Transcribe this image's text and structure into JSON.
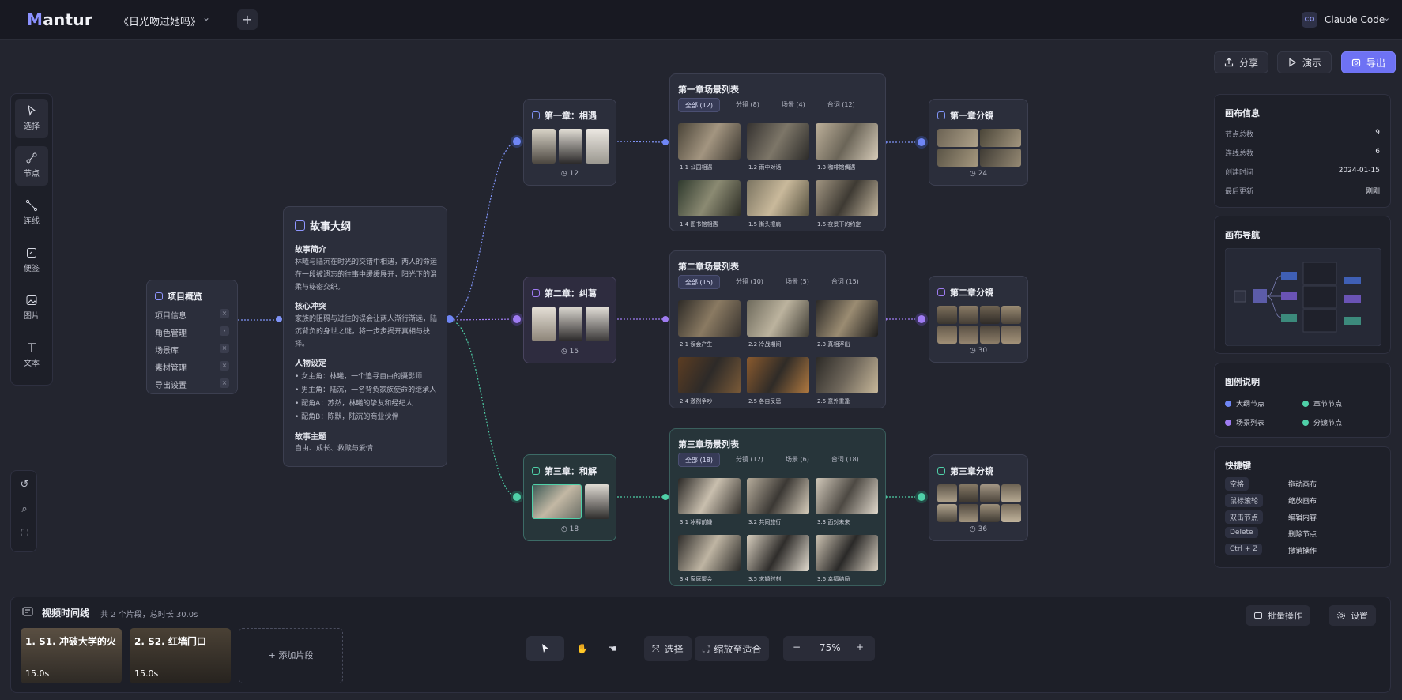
{
  "app": {
    "logo": "antur",
    "logo_initial": "M",
    "project_title": "《日光吻过她吗》",
    "agent_label": "Claude Code",
    "agent_icon_text": "CO"
  },
  "actions": {
    "share": "分享",
    "present": "演示",
    "export": "导出"
  },
  "tools": [
    {
      "label": "选择",
      "icon": "cursor-icon"
    },
    {
      "label": "节点",
      "icon": "node-icon"
    },
    {
      "label": "连线",
      "icon": "connector-icon"
    },
    {
      "label": "便签",
      "icon": "note-icon"
    },
    {
      "label": "图片",
      "icon": "image-icon"
    },
    {
      "label": "文本",
      "icon": "text-icon"
    }
  ],
  "overview": {
    "title": "项目概览",
    "items": [
      "项目信息",
      "角色管理",
      "场景库",
      "素材管理",
      "导出设置"
    ]
  },
  "outline": {
    "title": "故事大纲",
    "synopsis_h": "故事简介",
    "synopsis": "林曦与陆沉在时光的交错中相遇，两人的命运在一段被遗忘的往事中缓缓展开，阳光下的温柔与秘密交织。",
    "conflict_h": "核心冲突",
    "conflict": "家族的阻碍与过往的误会让两人渐行渐远，陆沉背负的身世之谜，将一步步揭开真相与抉择。",
    "characters_h": "人物设定",
    "characters": [
      "女主角：林曦，一个追寻自由的摄影师",
      "男主角：陆沉，一名背负家族使命的继承人",
      "配角A：苏然，林曦的挚友和经纪人",
      "配角B：陈默，陆沉的商业伙伴"
    ],
    "theme_h": "故事主题",
    "theme": "自由、成长、救赎与爱情"
  },
  "chapters": [
    {
      "title": "第一章：相遇",
      "count": "12"
    },
    {
      "title": "第二章：纠葛",
      "count": "15"
    },
    {
      "title": "第三章：和解",
      "count": "18"
    }
  ],
  "scenes": [
    {
      "title": "第一章场景列表",
      "tabs": [
        "全部 (12)",
        "分镜 (8)",
        "场景 (4)",
        "台词 (12)"
      ],
      "shots": [
        "1.1 公园相遇",
        "1.2 雨中对话",
        "1.3 咖啡馆偶遇",
        "1.4 图书馆相遇",
        "1.5 街头擦肩",
        "1.6 夜景下的约定"
      ]
    },
    {
      "title": "第二章场景列表",
      "tabs": [
        "全部 (15)",
        "分镜 (10)",
        "场景 (5)",
        "台词 (15)"
      ],
      "shots": [
        "2.1 误会产生",
        "2.2 冷战期间",
        "2.3 真相浮出",
        "2.4 激烈争吵",
        "2.5 各自反思",
        "2.6 意外重逢"
      ]
    },
    {
      "title": "第三章场景列表",
      "tabs": [
        "全部 (18)",
        "分镜 (12)",
        "场景 (6)",
        "台词 (18)"
      ],
      "shots": [
        "3.1 冰释前嫌",
        "3.2 共同旅行",
        "3.3 面对未来",
        "3.4 家庭聚会",
        "3.5 求婚时刻",
        "3.6 幸福结局"
      ]
    }
  ],
  "storyboards": [
    {
      "title": "第一章分镜",
      "count": "24"
    },
    {
      "title": "第二章分镜",
      "count": "30"
    },
    {
      "title": "第三章分镜",
      "count": "36"
    }
  ],
  "canvas_info": {
    "title": "画布信息",
    "rows": [
      {
        "k": "节点总数",
        "v": "9"
      },
      {
        "k": "连线总数",
        "v": "6"
      },
      {
        "k": "创建时间",
        "v": "2024-01-15"
      },
      {
        "k": "最后更新",
        "v": "刚刚"
      }
    ]
  },
  "canvas_nav": {
    "title": "画布导航"
  },
  "legend": {
    "title": "图例说明",
    "items": [
      "大纲节点",
      "章节节点",
      "场景列表",
      "分镜节点"
    ],
    "colors": [
      "#6f86f5",
      "#4fd0a8",
      "#9f7cf2",
      "#4fd0a8"
    ]
  },
  "shortcuts": {
    "title": "快捷键",
    "rows": [
      {
        "key": "空格",
        "desc": "拖动画布"
      },
      {
        "key": "鼠标滚轮",
        "desc": "缩放画布"
      },
      {
        "key": "双击节点",
        "desc": "编辑内容"
      },
      {
        "key": "Delete",
        "desc": "删除节点"
      },
      {
        "key": "Ctrl + Z",
        "desc": "撤销操作"
      }
    ]
  },
  "timeline": {
    "title": "视频时间线",
    "summary": "共 2 个片段，总时长 30.0s",
    "clips": [
      {
        "name": "1. S1. 冲破大学的火",
        "duration": "15.0s"
      },
      {
        "name": "2. S2. 红墙门口",
        "duration": "15.0s"
      }
    ],
    "add_clip": "+ 添加片段",
    "batch": "批量操作",
    "settings": "设置"
  },
  "toolbar": {
    "select": "选择",
    "fit": "缩放至适合",
    "zoom": "75%",
    "minus": "−",
    "plus": "+"
  },
  "colors": {
    "accent": "#6e72f4",
    "outline": "#6f86f5",
    "chapter2": "#9f7cf2",
    "chapter3": "#4fd0a8"
  }
}
